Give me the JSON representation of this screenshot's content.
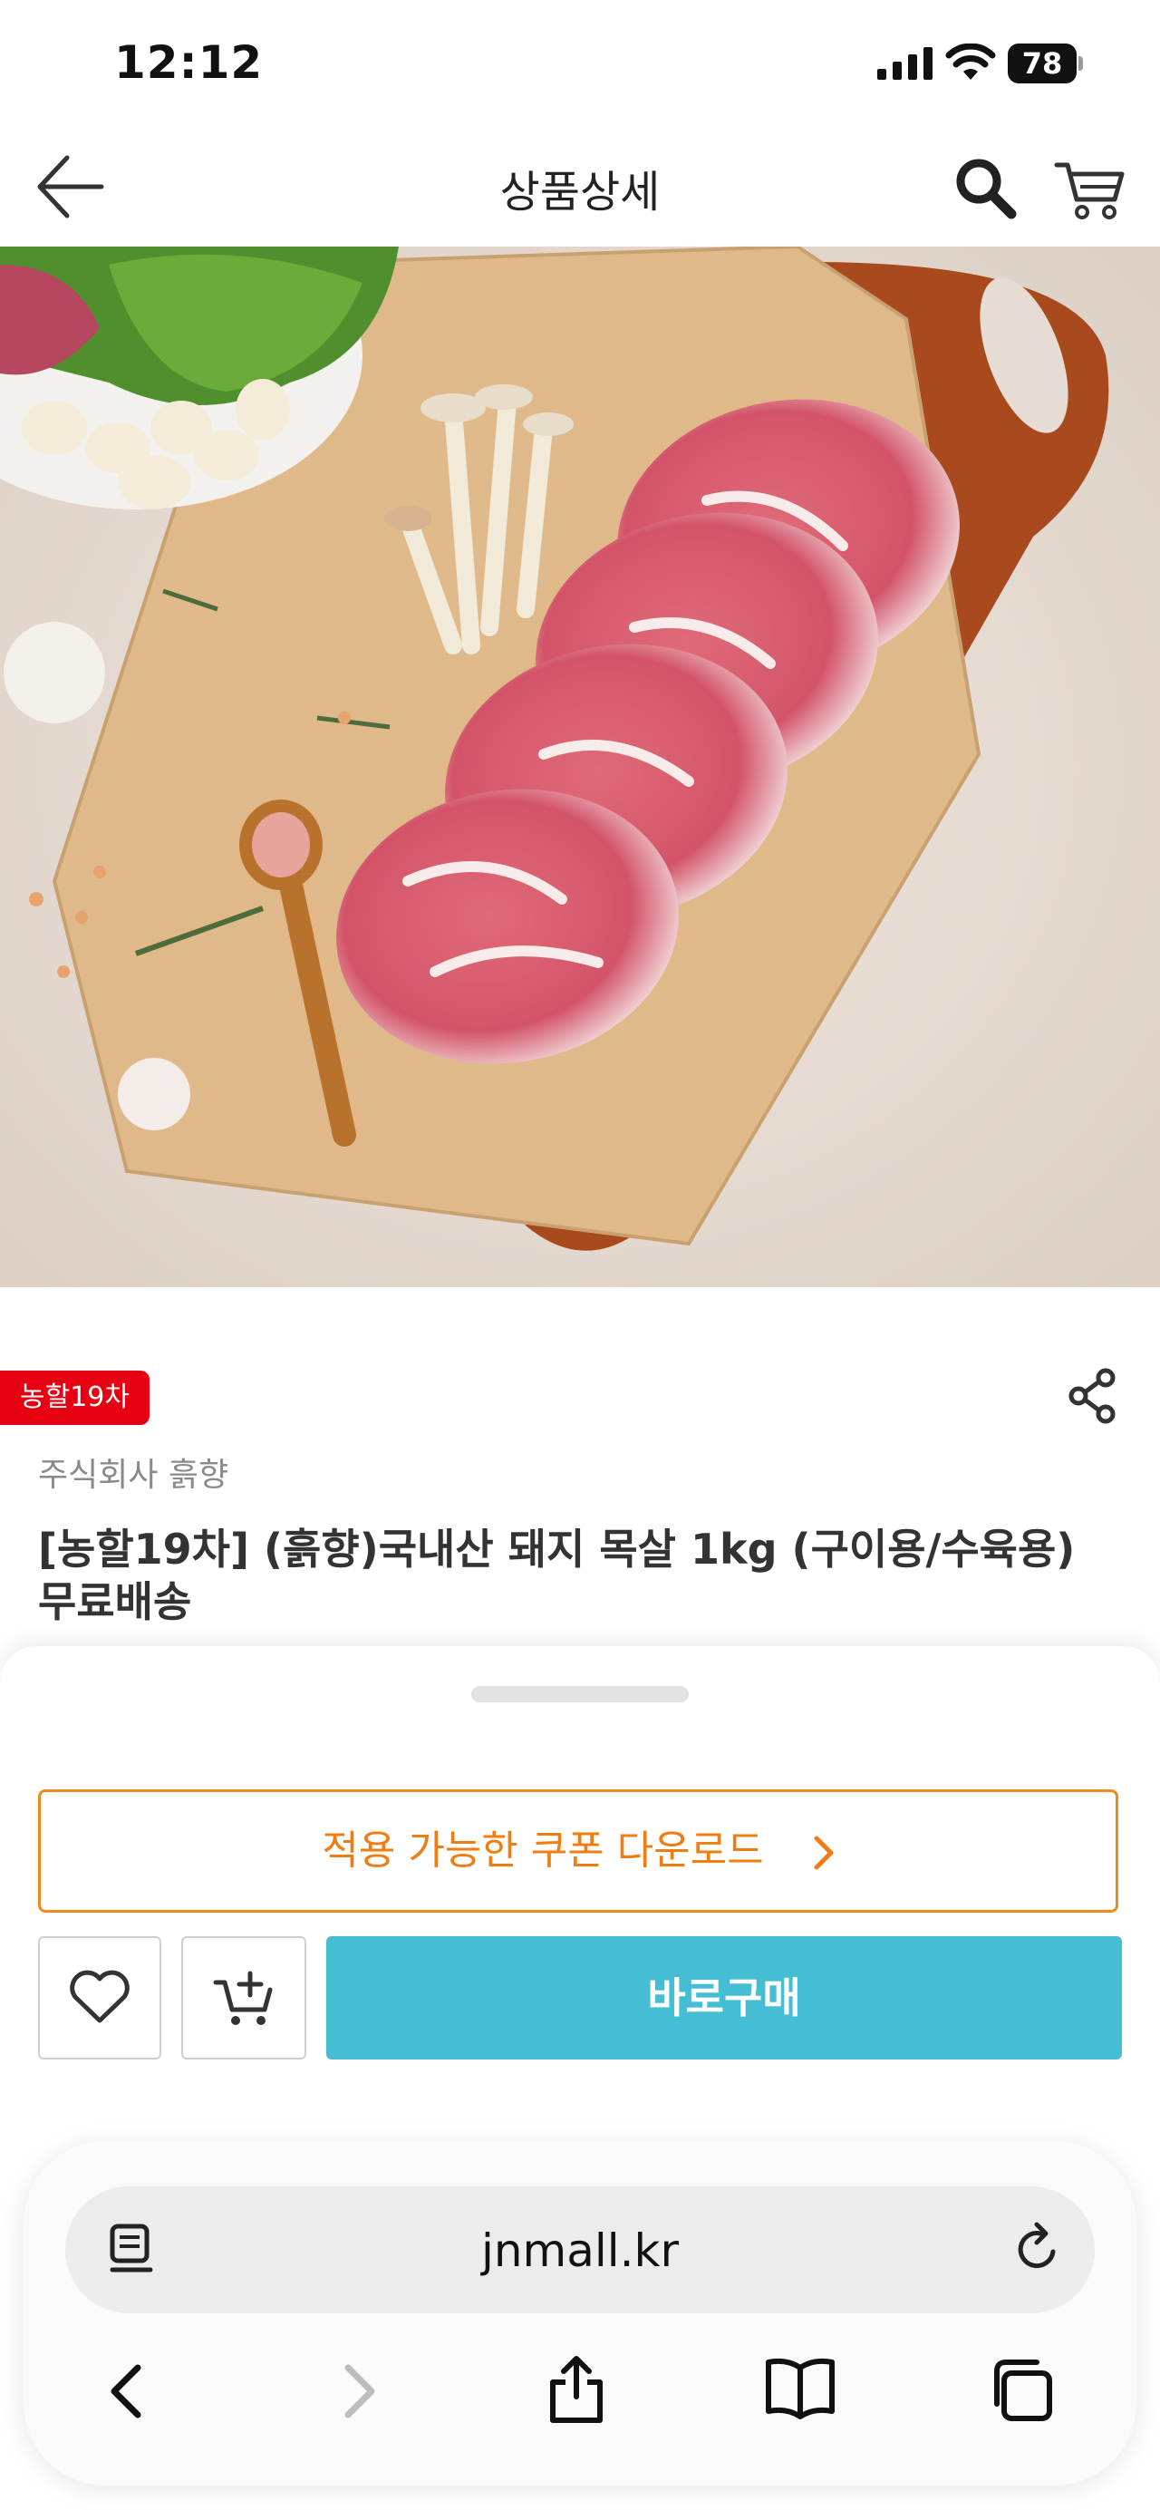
{
  "status_bar": {
    "time": "12:12",
    "battery": "78"
  },
  "header": {
    "title": "상품상세"
  },
  "product": {
    "badge": "농할19차",
    "seller": "주식회사 흙향",
    "title": "[농할19차] (흙향)국내산 돼지 목살 1kg (구이용/수육용) 무료배송"
  },
  "actions": {
    "coupon_label": "적용 가능한 쿠폰 다운로드",
    "buy_label": "바로구매"
  },
  "browser": {
    "url": "jnmall.kr"
  },
  "colors": {
    "badge": "#e60012",
    "coupon_accent": "#f07d12",
    "buy_button": "#45bdd2"
  },
  "icons": {
    "header": [
      "back-arrow-icon",
      "search-icon",
      "cart-icon"
    ],
    "product": [
      "share-icon"
    ],
    "actions": [
      "heart-icon",
      "cart-plus-icon",
      "chevron-right-icon"
    ],
    "browser": [
      "reader-icon",
      "reload-icon",
      "chevron-left-icon",
      "chevron-right-icon",
      "share-icon",
      "book-icon",
      "tabs-icon"
    ]
  }
}
